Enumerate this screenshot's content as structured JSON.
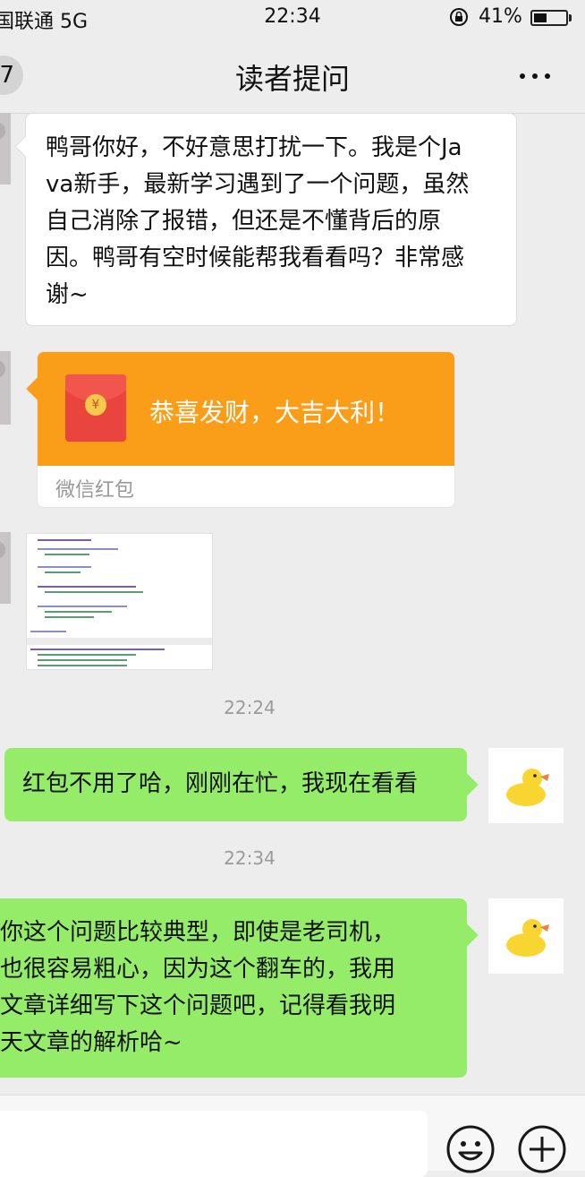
{
  "status_bar": {
    "carrier": "国联通 5G",
    "time": "22:34",
    "battery": "41%",
    "battery_level": 0.41
  },
  "nav": {
    "back_count": "7",
    "title": "读者提问",
    "more_icon": "more-dots-icon"
  },
  "messages": {
    "question": {
      "line1": "鸭哥你好，不好意思打扰一下。我是个Ja",
      "line2": "va新手，最新学习遇到了一个问题，虽然",
      "line3": "自己消除了报错，但还是不懂背后的原",
      "line4": "因。鸭哥有空时候能帮我看看吗？非常感",
      "line5": "谢~"
    },
    "red_packet": {
      "greeting": "恭喜发财，大吉大利！",
      "footer": "微信红包",
      "coin_symbol": "¥",
      "color": "#fa9d19"
    },
    "image_icon": "code-screenshot-image",
    "time1": "22:24",
    "reply1": "红包不用了哈，刚刚在忙，我现在看看",
    "time2": "22:34",
    "reply2": {
      "line1": "你这个问题比较典型，即使是老司机，",
      "line2": "也很容易粗心，因为这个翻车的，我用",
      "line3": "文章详细写下这个问题吧，记得看我明",
      "line4": "天文章的解析哈~"
    }
  },
  "input_bar": {
    "emoji_icon": "emoji-icon",
    "plus_icon": "plus-icon"
  },
  "colors": {
    "background": "#ededed",
    "green_bubble": "#95ec69",
    "white_bubble": "#ffffff"
  }
}
